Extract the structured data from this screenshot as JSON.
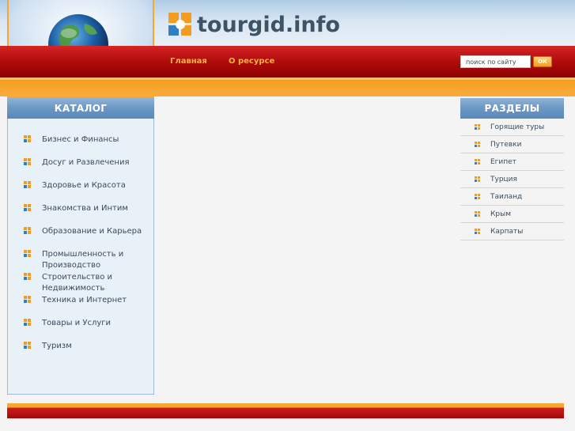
{
  "header": {
    "logo_text": "tourgid.info",
    "nav": [
      {
        "label": "Главная"
      },
      {
        "label": "О ресурсе"
      }
    ],
    "search": {
      "placeholder": "поиск по сайту",
      "button_label": "ОК"
    }
  },
  "catalog": {
    "title": "КАТАЛОГ",
    "items": [
      {
        "label": "Бизнес и Финансы"
      },
      {
        "label": "Досуг и Развлечения"
      },
      {
        "label": "Здоровье и Красота"
      },
      {
        "label": "Знакомства и Интим"
      },
      {
        "label": "Образование и Карьера"
      },
      {
        "label": "Промышленность и Производство"
      },
      {
        "label": "Строительство и Недвижимость"
      },
      {
        "label": "Техника и Интернет"
      },
      {
        "label": "Товары и Услуги"
      },
      {
        "label": "Туризм"
      }
    ]
  },
  "sections": {
    "title": "РАЗДЕЛЫ",
    "items": [
      {
        "label": "Горящие туры"
      },
      {
        "label": "Путевки"
      },
      {
        "label": "Египет"
      },
      {
        "label": "Турция"
      },
      {
        "label": "Таиланд"
      },
      {
        "label": "Крым"
      },
      {
        "label": "Карпаты"
      }
    ]
  },
  "colors": {
    "brand_orange": "#f39c1e",
    "brand_red": "#b30e0e",
    "panel_blue": "#6b97c4",
    "nav_text": "#f5b53a"
  }
}
